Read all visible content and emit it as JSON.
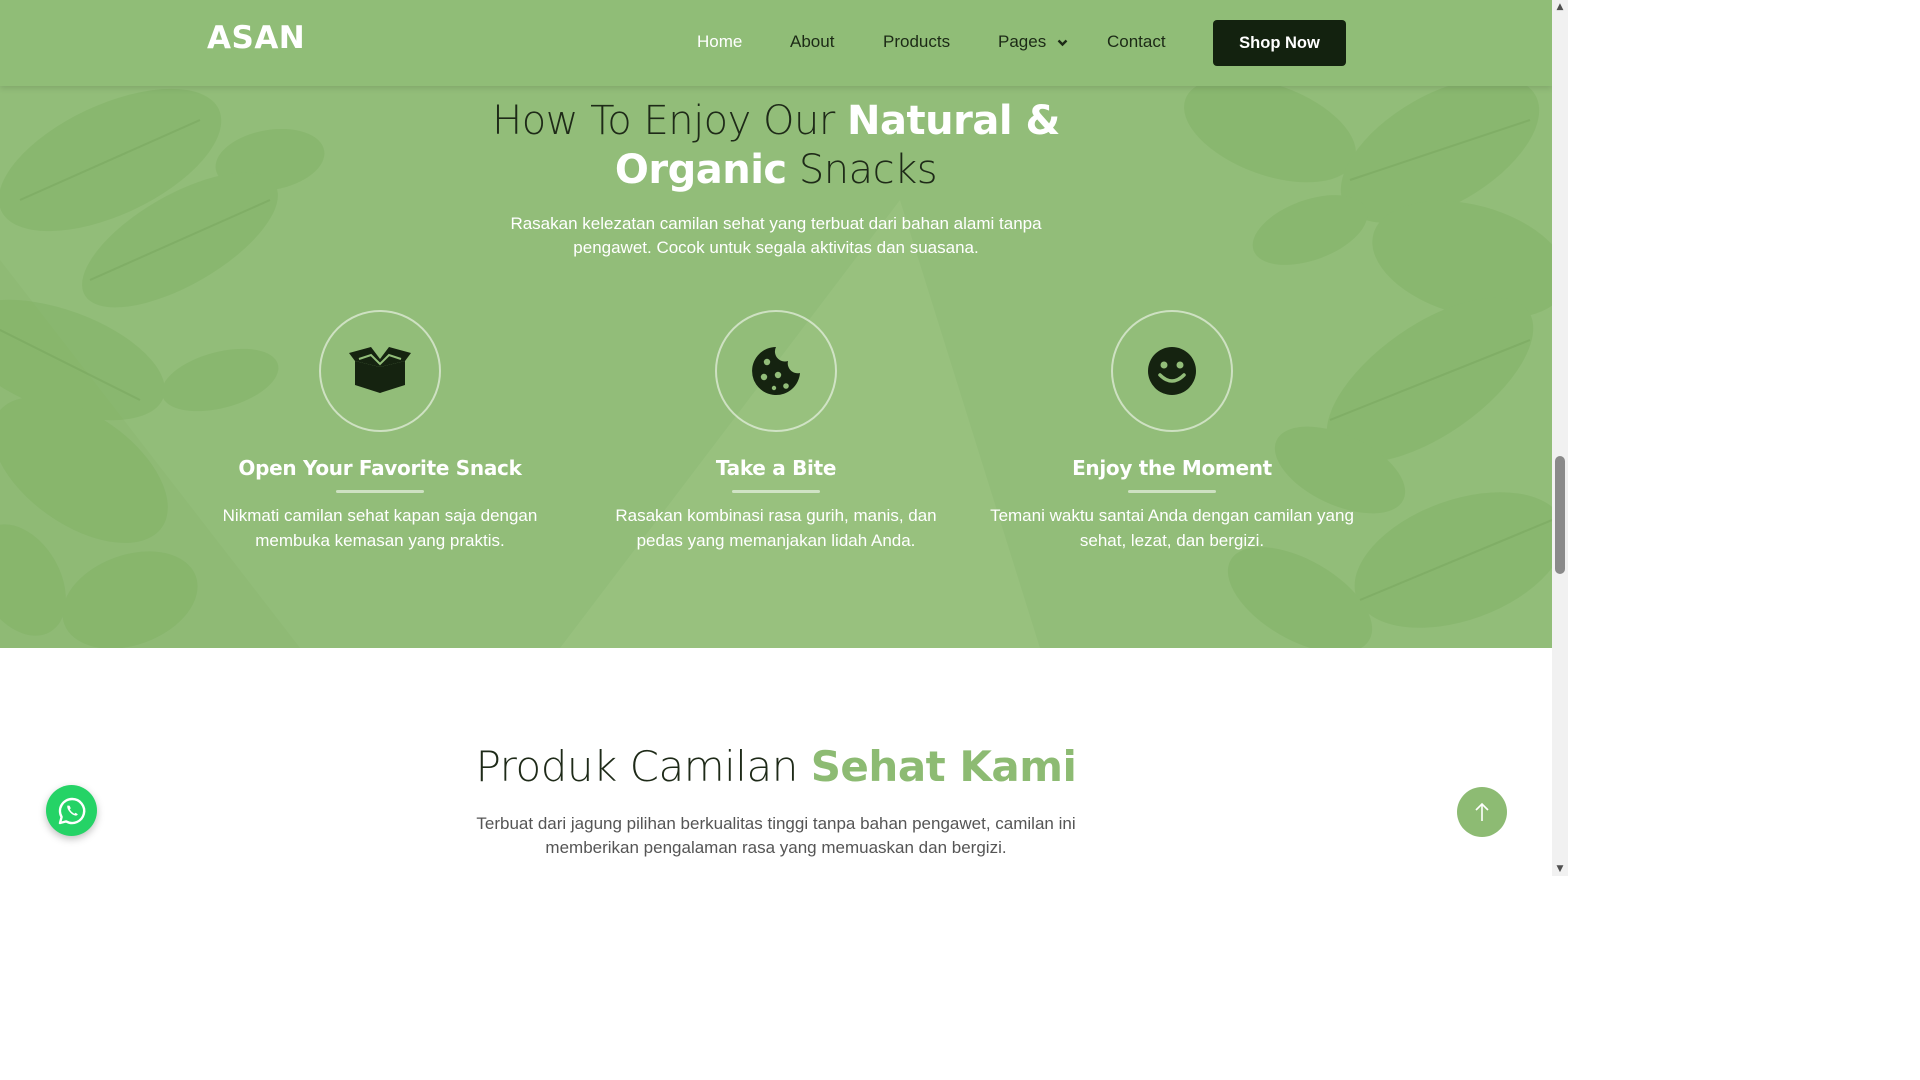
{
  "navbar": {
    "logo": "ASAN",
    "items": [
      {
        "label": "Home",
        "active": true
      },
      {
        "label": "About"
      },
      {
        "label": "Products"
      },
      {
        "label": "Pages",
        "dropdown": true
      },
      {
        "label": "Contact"
      }
    ],
    "cta": "Shop Now"
  },
  "hero": {
    "title_light_1": "How To Enjoy Our ",
    "title_bold_1": "Natural &",
    "title_bold_2": "Organic",
    "title_light_2": " Snacks",
    "subtitle": "Rasakan kelezatan camilan sehat yang terbuat dari bahan alami tanpa pengawet. Cocok untuk segala aktivitas dan suasana."
  },
  "features": [
    {
      "icon": "open-box-icon",
      "title": "Open Your Favorite Snack",
      "description": "Nikmati camilan sehat kapan saja dengan membuka kemasan yang praktis."
    },
    {
      "icon": "cookie-icon",
      "title": "Take a Bite",
      "description": "Rasakan kombinasi rasa gurih, manis, dan pedas yang memanjakan lidah Anda."
    },
    {
      "icon": "smile-icon",
      "title": "Enjoy the Moment",
      "description": "Temani waktu santai Anda dengan camilan yang sehat, lezat, dan bergizi."
    }
  ],
  "products": {
    "title_light": "Produk Camilan ",
    "title_accent": "Sehat Kami",
    "subtitle": "Terbuat dari jagung pilihan berkualitas tinggi tanpa bahan pengawet, camilan ini memberikan pengalaman rasa yang memuaskan dan bergizi."
  },
  "floating": {
    "whatsapp_icon": "whatsapp-icon",
    "back_to_top_icon": "arrow-up-icon"
  },
  "colors": {
    "hero_green": "#92bd79",
    "accent_green": "#8dbb73",
    "dark": "#13220f",
    "whatsapp": "#25d366"
  }
}
